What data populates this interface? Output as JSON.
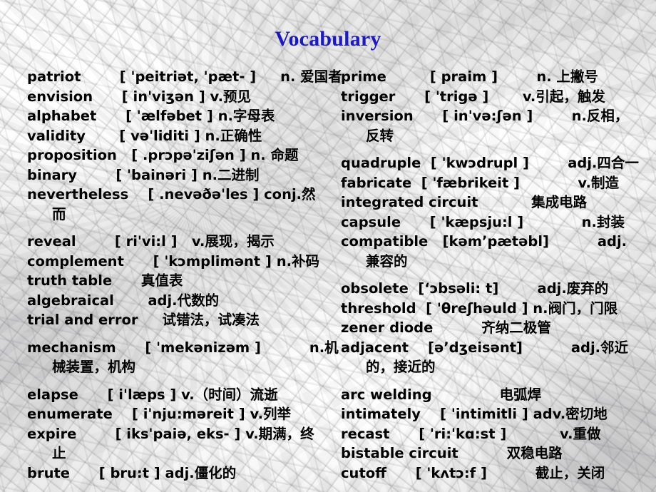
{
  "slide": {
    "title": "Vocabulary",
    "title_color": "#1b19c4",
    "text_color": "#000000",
    "background": "marble-texture"
  },
  "columns": {
    "left": [
      {
        "line1": "patriot        [ 'peitriət, 'pæt- ]     n. 爱国者"
      },
      {
        "line1": "envision      [ in'viʒən ] v.预见"
      },
      {
        "line1": "alphabet      [ 'ælfəbet ] n.字母表"
      },
      {
        "line1": "validity       [ və'liditi ] n.正确性"
      },
      {
        "line1": "proposition   [ .prɔpə'ziʃən ] n. 命题"
      },
      {
        "line1": "binary        [ 'bainəri ] n.二进制"
      },
      {
        "line1": "nevertheless    [ .nevəðə'les ] conj.然",
        "line2": "而"
      },
      {
        "line1": "reveal        [ ri'vi:l ]   v.展现，揭示"
      },
      {
        "line1": "complement      [ 'kɔmplimənt ] n.补码"
      },
      {
        "line1": "truth table      真值表"
      },
      {
        "line1": "algebraical       adj.代数的"
      },
      {
        "line1": "trial and error     试错法，试凑法"
      },
      {
        "line1": "mechanism      [ 'mekənizəm ]          n.机",
        "line2": "械装置，机构"
      },
      {
        "line1": "elapse      [ i'læps ] v.（时间）流逝"
      },
      {
        "line1": "enumerate    [ i'nju:məreit ] v.列举"
      },
      {
        "line1": "expire        [ iks'paiə, eks- ] v.期满，终",
        "line2": "止"
      },
      {
        "line1": "brute      [ bru:t ] adj.僵化的"
      }
    ],
    "right": [
      {
        "line1": "prime         [ praim ]        n. 上撇号"
      },
      {
        "line1": "trigger      [ 'trigə ]       v.引起，触发"
      },
      {
        "line1": "inversion      [ in'və:ʃən ]        n.反相，",
        "line2": "反转"
      },
      {
        "line1": "quadruple  [ 'kwɔdrupl ]        adj.四合一"
      },
      {
        "line1": "fabricate  [ 'fæbrikeit ]            v.制造"
      },
      {
        "line1": "integrated circuit           集成电路"
      },
      {
        "line1": "capsule      [ 'kæpsju:l ]            n.封装"
      },
      {
        "line1": "compatible   [kəm’pætəbl]          adj.",
        "line2": "兼容的"
      },
      {
        "line1": "obsolete  [‘ɔbsəli: t]        adj.废弃的"
      },
      {
        "line1": "threshold  [ 'θreʃhəuld ] n.阀门，门限"
      },
      {
        "line1": "zener diode          齐纳二极管"
      },
      {
        "line1": "adjacent    [ə’dʒeisənt]          adj.邻近",
        "line2": "的，接近的"
      },
      {
        "line1": "arc welding              电弧焊"
      },
      {
        "line1": "intimately    [ 'intimitli ] adv.密切地"
      },
      {
        "line1": "recast      [ 'ri:'kɑ:st ]           v.重做"
      },
      {
        "line1": "bistable circuit          双稳电路"
      },
      {
        "line1": "cutoff      [ 'kʌtɔ:f ]          截止，关闭"
      }
    ]
  },
  "layout": {
    "left_gaps_after": [
      6,
      11,
      12,
      16
    ],
    "right_gaps_after": [
      2,
      7,
      11
    ]
  }
}
